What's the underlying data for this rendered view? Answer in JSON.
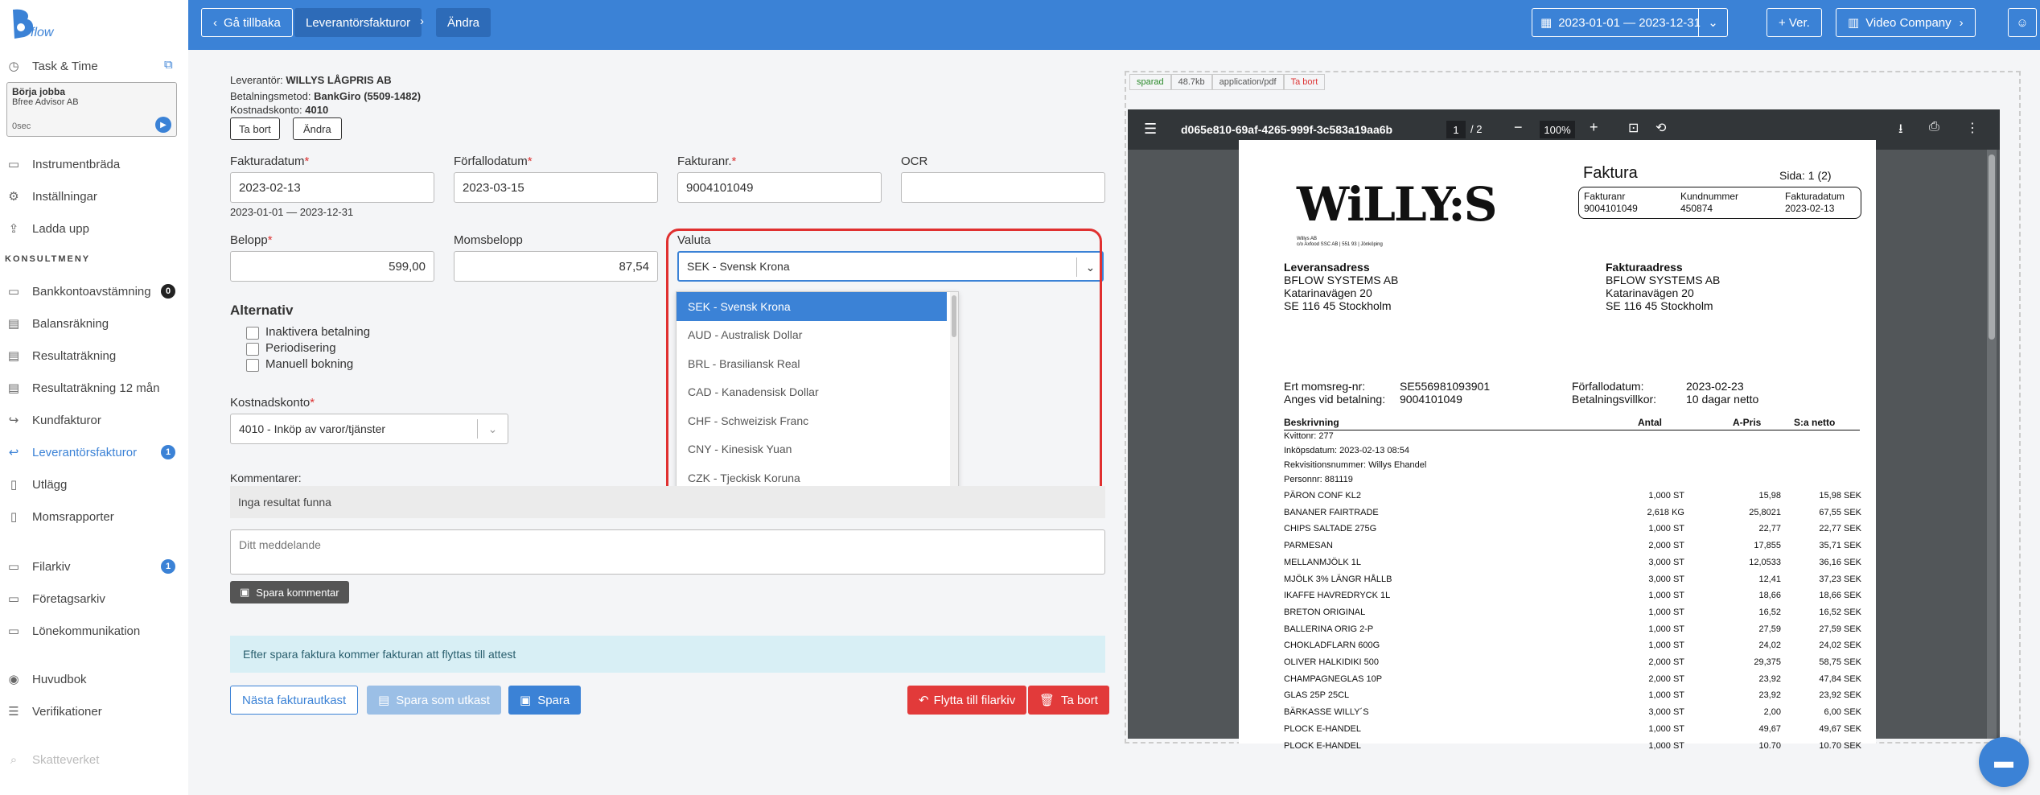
{
  "app": {
    "logo_text": "flow"
  },
  "sidebar": {
    "task_time": "Task & Time",
    "task_box": {
      "title": "Börja jobba",
      "company": "Bfree Advisor AB",
      "timer": "0sec"
    },
    "items_top": [
      {
        "label": "Instrumentbräda",
        "icon": "dashboard-icon"
      },
      {
        "label": "Inställningar",
        "icon": "gear-icon"
      },
      {
        "label": "Ladda upp",
        "icon": "upload-icon"
      }
    ],
    "section": "KONSULTMENY",
    "items": [
      {
        "label": "Bankkontoavstämning",
        "badge": "0"
      },
      {
        "label": "Balansräkning"
      },
      {
        "label": "Resultaträkning"
      },
      {
        "label": "Resultaträkning 12 mån"
      },
      {
        "label": "Kundfakturor"
      },
      {
        "label": "Leverantörsfakturor",
        "badge": "1"
      },
      {
        "label": "Utlägg"
      },
      {
        "label": "Momsrapporter"
      },
      {
        "label": "Filarkiv",
        "badge": "1"
      },
      {
        "label": "Företagsarkiv"
      },
      {
        "label": "Lönekommunikation"
      },
      {
        "label": "Huvudbok"
      },
      {
        "label": "Verifikationer"
      },
      {
        "label": "Skatteverket"
      }
    ]
  },
  "topbar": {
    "back": "Gå tillbaka",
    "crumb1": "Leverantörsfakturor",
    "crumb2": "Ändra",
    "date_range": "2023-01-01 — 2023-12-31",
    "ver": "+ Ver.",
    "company": "Video Company"
  },
  "form": {
    "supplier_label": "Leverantör:",
    "supplier": "WILLYS LÅGPRIS AB",
    "payment_label": "Betalningsmetod:",
    "payment": "BankGiro (5509-1482)",
    "account_label": "Kostnadskonto:",
    "account": "4010",
    "btn_remove": "Ta bort",
    "btn_change": "Ändra",
    "invoice_date_label": "Fakturadatum",
    "invoice_date": "2023-02-13",
    "date_range_hint": "2023-01-01 — 2023-12-31",
    "due_date_label": "Förfallodatum",
    "due_date": "2023-03-15",
    "invoice_nr_label": "Fakturanr.",
    "invoice_nr": "9004101049",
    "ocr_label": "OCR",
    "ocr": "",
    "amount_label": "Belopp",
    "amount": "599,00",
    "vat_label": "Momsbelopp",
    "vat": "87,54",
    "currency_label": "Valuta",
    "currency": "SEK - Svensk Krona",
    "currency_options": [
      "SEK - Svensk Krona",
      "AUD - Australisk Dollar",
      "BRL - Brasiliansk Real",
      "CAD - Kanadensisk Dollar",
      "CHF - Schweizisk Franc",
      "CNY - Kinesisk Yuan",
      "CZK - Tjeckisk Koruna"
    ],
    "alt_label": "Alternativ",
    "alt_options": [
      "Inaktivera betalning",
      "Periodisering",
      "Manuell bokning"
    ],
    "cost_account_label": "Kostnadskonto",
    "cost_account": "4010 - Inköp av varor/tjänster",
    "comments_label": "Kommentarer:",
    "no_results": "Inga resultat funna",
    "message_placeholder": "Ditt meddelande",
    "save_comment": "Spara kommentar",
    "info": "Efter spara faktura kommer fakturan att flyttas till attest",
    "next_draft": "Nästa fakturautkast",
    "save_draft": "Spara som utkast",
    "save": "Spara",
    "move_archive": "Flytta till filarkiv",
    "delete": "Ta bort"
  },
  "pdf": {
    "tabs": [
      "sparad",
      "48.7kb",
      "application/pdf",
      "Ta bort"
    ],
    "filename": "d065e810-69af-4265-999f-3c583a19aa6b",
    "page": "1",
    "pages": "/ 2",
    "zoom": "100%",
    "doc": {
      "brand": "WiLLY:S",
      "brand_sub": "Willys AB\nc/o Axfood SSC AB | 551 93 | Jönköping",
      "title": "Faktura",
      "page_label": "Sida: 1 (2)",
      "h_fakturanr": "Fakturanr",
      "v_fakturanr": "9004101049",
      "h_kundnr": "Kundnummer",
      "v_kundnr": "450874",
      "h_datum": "Fakturadatum",
      "v_datum": "2023-02-13",
      "lev_title": "Leveransadress",
      "lev_lines": [
        "BFLOW SYSTEMS AB",
        "Katarinavägen 20",
        "SE 116 45 Stockholm"
      ],
      "fakt_title": "Fakturaadress",
      "fakt_lines": [
        "BFLOW SYSTEMS AB",
        "Katarinavägen 20",
        "SE 116 45 Stockholm"
      ],
      "moms_label": "Ert momsreg-nr:",
      "moms_val": "SE556981093901",
      "ange_label": "Anges vid betalning:",
      "ange_val": "9004101049",
      "forf_label": "Förfallodatum:",
      "forf_val": "2023-02-23",
      "villkor_label": "Betalningsvillkor:",
      "villkor_val": "10 dagar netto",
      "col_desc": "Beskrivning",
      "col_qty": "Antal",
      "col_price": "A-Pris",
      "col_net": "S:a netto",
      "meta": [
        "Kvittonr: 277",
        "Inköpsdatum: 2023-02-13 08:54",
        "Rekvisitionsnummer: Willys Ehandel",
        "Personnr: 881119"
      ],
      "rows": [
        [
          "PÄRON CONF KL2",
          "1,000 ST",
          "15,98",
          "15,98 SEK"
        ],
        [
          "BANANER FAIRTRADE",
          "2,618 KG",
          "25,8021",
          "67,55 SEK"
        ],
        [
          "CHIPS SALTADE 275G",
          "1,000 ST",
          "22,77",
          "22,77 SEK"
        ],
        [
          "PARMESAN",
          "2,000 ST",
          "17,855",
          "35,71 SEK"
        ],
        [
          "MELLANMJÖLK 1L",
          "3,000 ST",
          "12,0533",
          "36,16 SEK"
        ],
        [
          "MJÖLK 3% LÄNGR HÅLLB",
          "3,000 ST",
          "12,41",
          "37,23 SEK"
        ],
        [
          "IKAFFE HAVREDRYCK 1L",
          "1,000 ST",
          "18,66",
          "18,66 SEK"
        ],
        [
          "BRETON ORIGINAL",
          "1,000 ST",
          "16,52",
          "16,52 SEK"
        ],
        [
          "BALLERINA ORIG 2-P",
          "1,000 ST",
          "27,59",
          "27,59 SEK"
        ],
        [
          "CHOKLADFLARN 600G",
          "1,000 ST",
          "24,02",
          "24,02 SEK"
        ],
        [
          "OLIVER HALKIDIKI 500",
          "2,000 ST",
          "29,375",
          "58,75 SEK"
        ],
        [
          "CHAMPAGNEGLAS 10P",
          "2,000 ST",
          "23,92",
          "47,84 SEK"
        ],
        [
          "GLAS 25P 25CL",
          "1,000 ST",
          "23,92",
          "23,92 SEK"
        ],
        [
          "BÄRKASSE WILLY´S",
          "3,000 ST",
          "2,00",
          "6,00 SEK"
        ],
        [
          "PLOCK E-HANDEL",
          "1,000 ST",
          "49,67",
          "49,67 SEK"
        ],
        [
          "PLOCK E-HANDEL",
          "1,000 ST",
          "10.70",
          "10.70 SEK"
        ]
      ]
    }
  },
  "colors": {
    "primary": "#3b82d6",
    "danger": "#e23a3a",
    "highlight": "#e03030",
    "pdf_bar": "#323639"
  }
}
